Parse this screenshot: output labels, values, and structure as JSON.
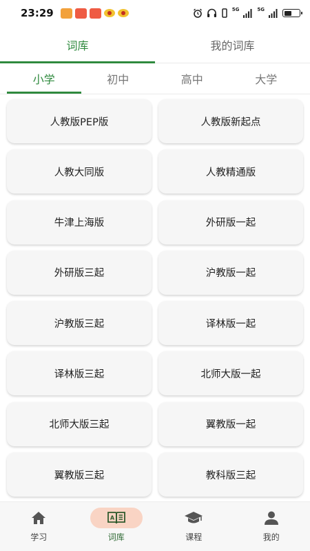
{
  "status_bar": {
    "time": "23:29",
    "network_label_1": "5G",
    "network_label_2": "5G"
  },
  "top_tabs": [
    {
      "label": "词库",
      "active": true
    },
    {
      "label": "我的词库",
      "active": false
    }
  ],
  "grade_tabs": [
    {
      "label": "小学",
      "active": true
    },
    {
      "label": "初中",
      "active": false
    },
    {
      "label": "高中",
      "active": false
    },
    {
      "label": "大学",
      "active": false
    }
  ],
  "textbooks": [
    "人教版PEP版",
    "人教版新起点",
    "人教大同版",
    "人教精通版",
    "牛津上海版",
    "外研版一起",
    "外研版三起",
    "沪教版一起",
    "沪教版三起",
    "译林版一起",
    "译林版三起",
    "北师大版一起",
    "北师大版三起",
    "翼教版一起",
    "翼教版三起",
    "教科版三起"
  ],
  "bottom_nav": [
    {
      "label": "学习",
      "icon": "home-icon",
      "active": false
    },
    {
      "label": "词库",
      "icon": "book-icon",
      "active": true
    },
    {
      "label": "课程",
      "icon": "graduation-cap-icon",
      "active": false
    },
    {
      "label": "我的",
      "icon": "person-icon",
      "active": false
    }
  ],
  "colors": {
    "accent": "#2f8a3e",
    "active_nav_pill": "#f9d4c4",
    "card_bg": "#f6f6f6"
  }
}
